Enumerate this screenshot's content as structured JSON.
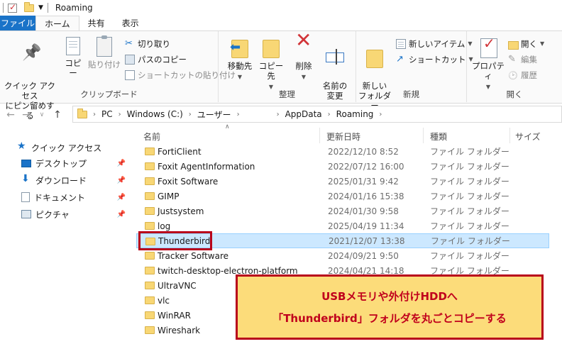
{
  "titlebar": {
    "title": "Roaming"
  },
  "tabs": [
    "ファイル",
    "ホーム",
    "共有",
    "表示"
  ],
  "ribbon": {
    "clipboard": {
      "label": "クリップボード",
      "pin": "クイック アクセス\nにピン留めする",
      "copy": "コピー",
      "paste": "貼り付け",
      "cut": "切り取り",
      "copy_path": "パスのコピー",
      "paste_shortcut": "ショートカットの貼り付け"
    },
    "organize": {
      "label": "整理",
      "move_to": "移動先",
      "copy_to": "コピー先",
      "delete": "削除",
      "rename": "名前の\n変更"
    },
    "new": {
      "label": "新規",
      "new_folder": "新しい\nフォルダー",
      "new_item": "新しいアイテム",
      "easy_access": "ショートカット"
    },
    "open": {
      "label": "開く",
      "properties": "プロパティ",
      "open": "開く",
      "edit": "編集",
      "history": "履歴"
    }
  },
  "address": {
    "crumbs": [
      "PC",
      "Windows (C:)",
      "ユーザー",
      "",
      "AppData",
      "Roaming"
    ]
  },
  "sidebar": {
    "items": [
      {
        "label": "クイック アクセス",
        "icon": "star-icon"
      },
      {
        "label": "デスクトップ",
        "icon": "desktop-icon"
      },
      {
        "label": "ダウンロード",
        "icon": "download-icon"
      },
      {
        "label": "ドキュメント",
        "icon": "documents-icon"
      },
      {
        "label": "ピクチャ",
        "icon": "pictures-icon"
      }
    ]
  },
  "columns": {
    "name": "名前",
    "date": "更新日時",
    "type": "種類",
    "size": "サイズ"
  },
  "files": [
    {
      "name": "FortiClient",
      "date": "2022/12/10 8:52",
      "type": "ファイル フォルダー"
    },
    {
      "name": "Foxit AgentInformation",
      "date": "2022/07/12 16:00",
      "type": "ファイル フォルダー"
    },
    {
      "name": "Foxit Software",
      "date": "2025/01/31 9:42",
      "type": "ファイル フォルダー"
    },
    {
      "name": "GIMP",
      "date": "2024/01/16 15:38",
      "type": "ファイル フォルダー"
    },
    {
      "name": "Justsystem",
      "date": "2024/01/30 9:58",
      "type": "ファイル フォルダー"
    },
    {
      "name": "log",
      "date": "2025/04/19 11:34",
      "type": "ファイル フォルダー"
    },
    {
      "name": "Thunderbird",
      "date": "2021/12/07 13:38",
      "type": "ファイル フォルダー"
    },
    {
      "name": "Tracker Software",
      "date": "2024/09/21 9:50",
      "type": "ファイル フォルダー"
    },
    {
      "name": "twitch-desktop-electron-platform",
      "date": "2024/04/21 14:18",
      "type": "ファイル フォルダー"
    },
    {
      "name": "UltraVNC",
      "date": "",
      "type": ""
    },
    {
      "name": "vlc",
      "date": "",
      "type": ""
    },
    {
      "name": "WinRAR",
      "date": "",
      "type": ""
    },
    {
      "name": "Wireshark",
      "date": "",
      "type": ""
    }
  ],
  "selected_index": 6,
  "callout": {
    "line1": "USBメモリや外付けHDDへ",
    "line2": "「Thunderbird」フォルダを丸ごとコピーする"
  },
  "colors": {
    "accent": "#1a73c8",
    "selection": "#cce8ff",
    "callout_bg": "#fcdc7a",
    "callout_border": "#b8001a"
  }
}
